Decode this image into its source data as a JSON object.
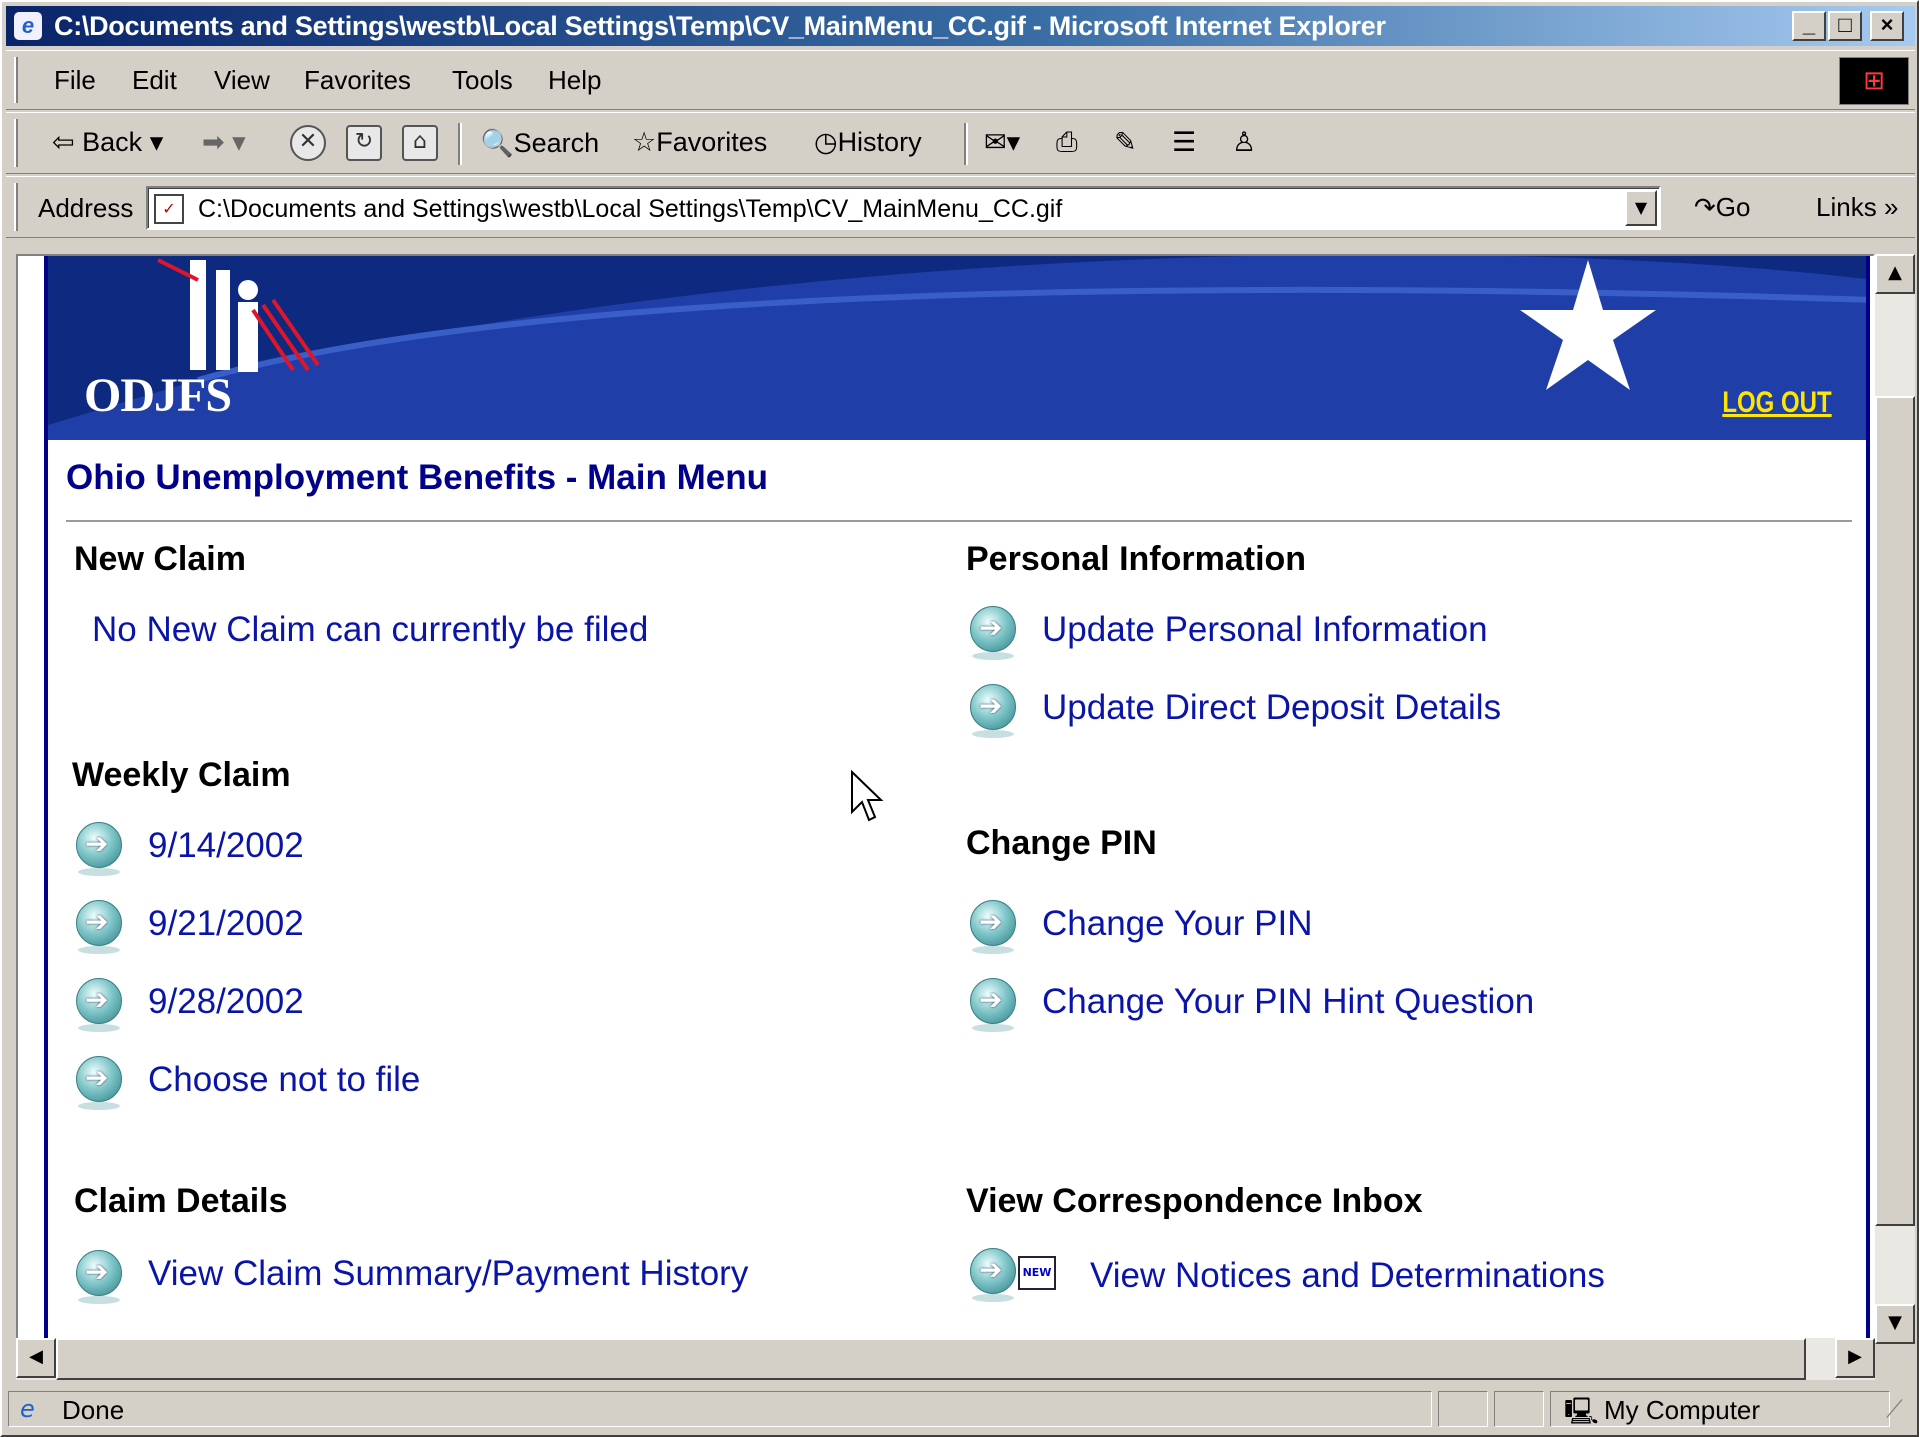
{
  "window": {
    "title": "C:\\Documents and Settings\\westb\\Local Settings\\Temp\\CV_MainMenu_CC.gif - Microsoft Internet Explorer",
    "min_label": "_",
    "max_label": "□",
    "close_label": "×"
  },
  "menubar": {
    "items": [
      "File",
      "Edit",
      "View",
      "Favorites",
      "Tools",
      "Help"
    ]
  },
  "toolbar": {
    "back_label": "Back",
    "search_label": "Search",
    "favorites_label": "Favorites",
    "history_label": "History"
  },
  "addressbar": {
    "label": "Address",
    "url": "C:\\Documents and Settings\\westb\\Local Settings\\Temp\\CV_MainMenu_CC.gif",
    "go_label": "Go",
    "links_label": "Links"
  },
  "page": {
    "logo_text": "ODJFS",
    "logout_label": "LOG OUT",
    "title": "Ohio Unemployment Benefits - Main Menu",
    "new_claim": {
      "heading": "New Claim",
      "message": "No New Claim can currently be filed"
    },
    "weekly_claim": {
      "heading": "Weekly Claim",
      "links": [
        "9/14/2002",
        "9/21/2002",
        "9/28/2002",
        "Choose not to file"
      ]
    },
    "claim_details": {
      "heading": "Claim Details",
      "link": "View Claim Summary/Payment History"
    },
    "personal_information": {
      "heading": "Personal Information",
      "links": [
        "Update Personal Information",
        "Update Direct Deposit Details"
      ]
    },
    "change_pin": {
      "heading": "Change PIN",
      "links": [
        "Change Your PIN",
        "Change Your PIN Hint Question"
      ]
    },
    "correspondence": {
      "heading": "View Correspondence Inbox",
      "badge": "NEW",
      "link": "View Notices and Determinations"
    }
  },
  "statusbar": {
    "status": "Done",
    "zone": "My Computer"
  },
  "colors": {
    "banner": "#1f3ea8",
    "link": "#0a15a8",
    "title": "#00008b",
    "logout": "#ffe600",
    "titlebar_start": "#0a246a"
  }
}
